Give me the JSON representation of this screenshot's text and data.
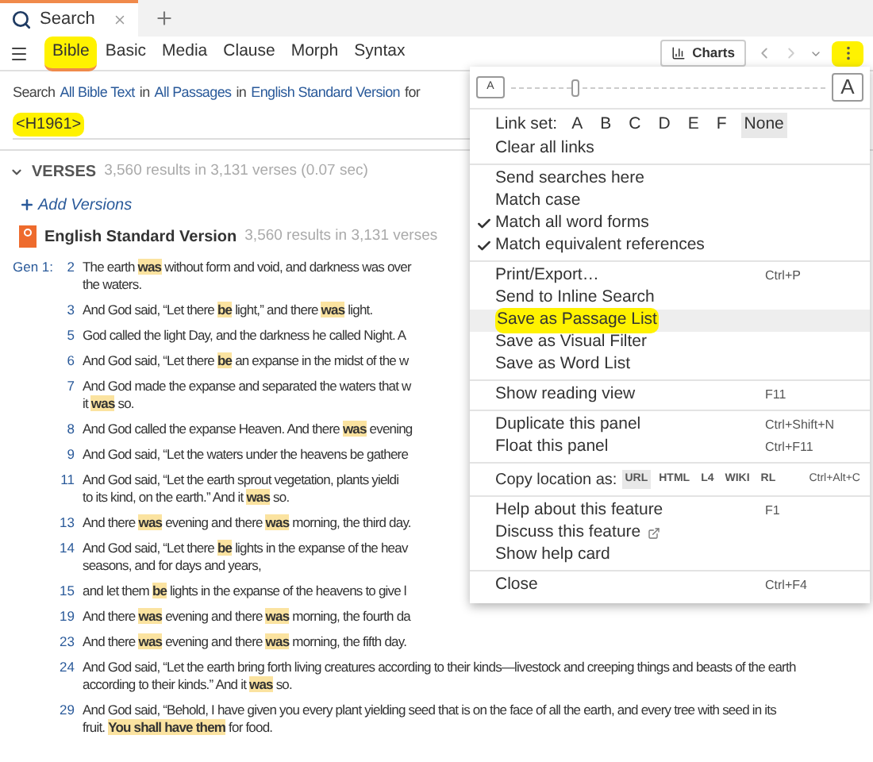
{
  "tabs": [
    {
      "label": "Search",
      "selected": true
    }
  ],
  "search_types": [
    {
      "label": "Bible",
      "selected": true,
      "marker": true
    },
    {
      "label": "Basic",
      "selected": false,
      "marker": false
    },
    {
      "label": "Media",
      "selected": false,
      "marker": false
    },
    {
      "label": "Clause",
      "selected": false,
      "marker": false
    },
    {
      "label": "Morph",
      "selected": false,
      "marker": false
    },
    {
      "label": "Syntax",
      "selected": false,
      "marker": false
    }
  ],
  "toolbar": {
    "charts_label": "Charts",
    "more_button_marker": true
  },
  "search_line": [
    {
      "kind": "text",
      "text": "Search"
    },
    {
      "kind": "link",
      "text": "All Bible Text"
    },
    {
      "kind": "text",
      "text": "in"
    },
    {
      "kind": "link",
      "text": "All Passages"
    },
    {
      "kind": "text",
      "text": "in"
    },
    {
      "kind": "link",
      "text": "English Standard Version"
    },
    {
      "kind": "text",
      "text": "for"
    }
  ],
  "query": {
    "value": "<H1961>",
    "marker": true
  },
  "results": {
    "expanded": true,
    "label": "VERSES",
    "summary": "3,560 results in 3,131 verses (0.07 sec)",
    "add_versions": "Add Versions",
    "version": {
      "name": "English Standard Version",
      "summary": "3,560 results in 3,131 verses"
    },
    "verses": [
      {
        "ref": "Gen 1:",
        "number": "2",
        "lines": [
          "The earth **was** without form and void, and darkness was over",
          "the waters."
        ]
      },
      {
        "number": "3",
        "lines": [
          "And God said, “Let there **be** light,” and there **was** light."
        ]
      },
      {
        "number": "5",
        "lines": [
          "God called the light Day, and the darkness he called Night. A"
        ]
      },
      {
        "number": "6",
        "lines": [
          "And God said, “Let there **be** an expanse in the midst of the w"
        ]
      },
      {
        "number": "7",
        "lines": [
          "And God made the expanse and separated the waters that w",
          "it **was** so."
        ]
      },
      {
        "number": "8",
        "lines": [
          "And God called the expanse Heaven. And there **was** evening"
        ]
      },
      {
        "number": "9",
        "lines": [
          "And God said, “Let the waters under the heavens be gathere"
        ]
      },
      {
        "number": "11",
        "lines": [
          "And God said, “Let the earth sprout vegetation, plants yieldi",
          "to its kind, on the earth.” And it **was** so."
        ]
      },
      {
        "number": "13",
        "lines": [
          "And there **was** evening and there **was** morning, the third day."
        ]
      },
      {
        "number": "14",
        "lines": [
          "And God said, “Let there **be** lights in the expanse of the heav",
          "seasons, and for days and years,"
        ]
      },
      {
        "number": "15",
        "lines": [
          "and let them **be** lights in the expanse of the heavens to give l"
        ]
      },
      {
        "number": "19",
        "lines": [
          "And there **was** evening and there **was** morning, the fourth da"
        ]
      },
      {
        "number": "23",
        "lines": [
          "And there **was** evening and there **was** morning, the fifth day."
        ]
      },
      {
        "number": "24",
        "lines": [
          "And God said, “Let the earth bring forth living creatures according to their kinds—livestock and creeping things and beasts of the earth",
          "according to their kinds.” And it **was** so."
        ]
      },
      {
        "number": "29",
        "lines": [
          "And God said, “Behold, I have given you every plant yielding seed that is on the face of all the earth, and every tree with seed in its",
          "fruit. **You shall have them** for food."
        ]
      }
    ]
  },
  "menu": {
    "slider": {
      "small_label": "A",
      "large_label": "A",
      "level": 0.2
    },
    "groups": [
      [
        {
          "kind": "linkset",
          "label": "Link set:",
          "options": [
            {
              "label": "A",
              "selected": false
            },
            {
              "label": "B",
              "selected": false
            },
            {
              "label": "C",
              "selected": false
            },
            {
              "label": "D",
              "selected": false
            },
            {
              "label": "E",
              "selected": false
            },
            {
              "label": "F",
              "selected": false
            },
            {
              "label": "None",
              "selected": true
            }
          ]
        },
        {
          "kind": "item",
          "label": "Clear all links"
        }
      ],
      [
        {
          "kind": "item",
          "label": "Send searches here",
          "checked": false
        },
        {
          "kind": "item",
          "label": "Match case",
          "checked": false
        },
        {
          "kind": "item",
          "label": "Match all word forms",
          "checked": true
        },
        {
          "kind": "item",
          "label": "Match equivalent references",
          "checked": true
        }
      ],
      [
        {
          "kind": "item",
          "label": "Print/Export…",
          "shortcut": "Ctrl+P",
          "selected": false,
          "marker": false
        },
        {
          "kind": "item",
          "label": "Send to Inline Search",
          "selected": false,
          "marker": false
        },
        {
          "kind": "item",
          "label": "Save as Passage List",
          "selected": true,
          "marker": true
        },
        {
          "kind": "item",
          "label": "Save as Visual Filter",
          "selected": false,
          "marker": false
        },
        {
          "kind": "item",
          "label": "Save as Word List",
          "selected": false,
          "marker": false
        }
      ],
      [
        {
          "kind": "item",
          "label": "Show reading view",
          "shortcut": "F11"
        }
      ],
      [
        {
          "kind": "item",
          "label": "Duplicate this panel",
          "shortcut": "Ctrl+Shift+N"
        },
        {
          "kind": "item",
          "label": "Float this panel",
          "shortcut": "Ctrl+F11"
        }
      ],
      [
        {
          "kind": "copy",
          "label": "Copy location as:",
          "formats": [
            {
              "label": "URL",
              "selected": true
            },
            {
              "label": "HTML",
              "selected": false
            },
            {
              "label": "L4",
              "selected": false
            },
            {
              "label": "WIKI",
              "selected": false
            },
            {
              "label": "RL",
              "selected": false
            }
          ],
          "shortcut": "Ctrl+Alt+C"
        }
      ],
      [
        {
          "kind": "item",
          "label": "Help about this feature",
          "shortcut": "F1",
          "external": false
        },
        {
          "kind": "item",
          "label": "Discuss this feature",
          "external": true
        },
        {
          "kind": "item",
          "label": "Show help card",
          "external": false
        }
      ],
      [
        {
          "kind": "item",
          "label": "Close",
          "shortcut": "Ctrl+F4"
        }
      ]
    ]
  }
}
